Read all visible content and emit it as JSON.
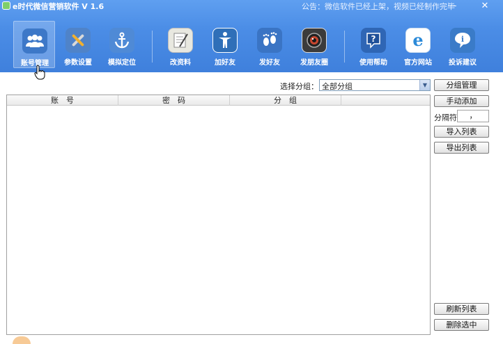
{
  "window": {
    "title": "e时代微信营销软件 V 1.6",
    "notice": "公告：微信软件已经上架，视频已经制作完毕",
    "min_glyph": "—",
    "close_glyph": "✕"
  },
  "toolbar": {
    "items": [
      {
        "label": "账号管理",
        "icon": "users-icon",
        "color": "#3d78c8"
      },
      {
        "label": "参数设置",
        "icon": "wrench-icon",
        "color": "#4f83c9"
      },
      {
        "label": "模拟定位",
        "icon": "anchor-icon",
        "color": "#4f8ad6"
      },
      {
        "label": "改资料",
        "icon": "notepad-icon",
        "color": "#e8e8e0"
      },
      {
        "label": "加好友",
        "icon": "person-icon",
        "color": "#2f6fb8"
      },
      {
        "label": "发好友",
        "icon": "footprints-icon",
        "color": "#3a74c4"
      },
      {
        "label": "发朋友圈",
        "icon": "camera-icon",
        "color": "#3b3b3b"
      },
      {
        "label": "使用帮助",
        "icon": "question-icon",
        "color": "#2f66b5"
      },
      {
        "label": "官方网站",
        "icon": "browser-icon",
        "color": "#2c8ad8"
      },
      {
        "label": "投诉建议",
        "icon": "info-icon",
        "color": "#3a7bc8"
      }
    ]
  },
  "group_filter": {
    "label": "选择分组：",
    "selected": "全部分组"
  },
  "table": {
    "columns": [
      "账　号",
      "密　码",
      "分　组",
      ""
    ]
  },
  "side_panel": {
    "group_manage": "分组管理",
    "manual_add": "手动添加",
    "separator_label": "分隔符",
    "separator_value": "，",
    "import_list": "导入列表",
    "export_list": "导出列表",
    "refresh_list": "刷新列表",
    "delete_selected": "删除选中"
  }
}
